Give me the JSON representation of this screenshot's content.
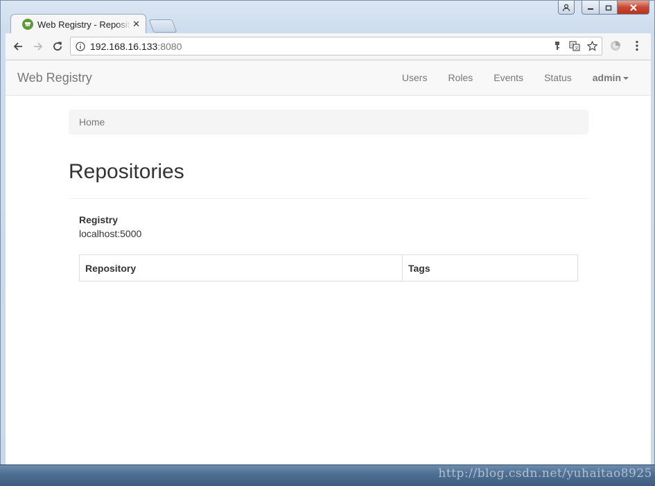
{
  "browser": {
    "tab_title": "Web Registry - Reposit",
    "tab_close": "✕",
    "url_host": "192.168.16.133",
    "url_port": ":8080"
  },
  "navbar": {
    "brand": "Web Registry",
    "links": [
      "Users",
      "Roles",
      "Events",
      "Status"
    ],
    "user_menu": "admin"
  },
  "breadcrumb": {
    "home": "Home"
  },
  "main": {
    "title": "Repositories",
    "registry_label": "Registry",
    "registry_value": "localhost:5000",
    "table": {
      "headers": [
        "Repository",
        "Tags"
      ],
      "rows": []
    }
  },
  "watermark": "http://blog.csdn.net/yuhaitao8925"
}
